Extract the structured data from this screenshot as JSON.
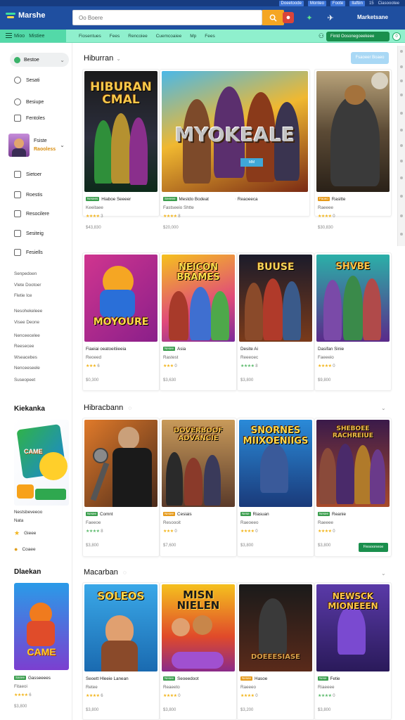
{
  "header": {
    "logo_text": "Marshe",
    "search_placeholder": "Oo Boere",
    "right_text": "Marketsane",
    "top_links": [
      "Doeetoode",
      "Monteo",
      "Foote",
      "Ilaftiin",
      "15",
      "Ciasoootee"
    ]
  },
  "nav": {
    "menu_label": "Mioo",
    "menu_label2": "Mistiee",
    "links": [
      "Fiosentues",
      "Fees",
      "Rencoiee",
      "Cuemcoaiee",
      "Mp",
      "Fees"
    ],
    "cta": "Fintd Oosonegoeekeee"
  },
  "sidebar": {
    "home": "Bestoe",
    "items": [
      "Sesati",
      "Besiupe",
      "Fentoles"
    ],
    "profile": {
      "name": "Fsiste",
      "level": "Raooless"
    },
    "items2": [
      "Sietoer",
      "Roestis",
      "Resocilere",
      "Sesiteig",
      "Fesiells"
    ],
    "links": [
      "Senpedoen",
      "Vlete Dootoer",
      "Fletie Ice",
      "Nesohekeleee",
      "Visee Deone",
      "Nenceecelee",
      "Reesecee",
      "Wseacebes",
      "Nenceeseele",
      "Suseopeet"
    ],
    "section1": {
      "title": "Kiekanka",
      "sub1": "Nestsbeveeoo",
      "sub2": "Nata",
      "item1": "Gieee",
      "item2": "Coaee"
    },
    "section2": {
      "title": "Dlaekan",
      "badge": "Sanee",
      "name": "Gasseeees",
      "meta": "Fitaeoi",
      "stars": "★★★★",
      "rating": "6",
      "price": "$3,800"
    }
  },
  "sections": [
    {
      "title": "Hiburran",
      "button": "Fsaoeer Boaeo",
      "cards": [
        {
          "cover": "HIBURAN CMAL",
          "badge": "Nesees",
          "name": "Hiaboe Seeeer",
          "meta": "Keeitaee",
          "stars": "★★★★",
          "rating": "3",
          "price": "$43,830"
        },
        {
          "cover": "MYOKEALE",
          "badge": "Seeeee",
          "name": "Mestdo Bodeat",
          "meta": "Fastseeio Shtte",
          "stars": "★★★★",
          "rating": "8",
          "price": "$20,000",
          "extra": "Reaoeeca"
        },
        {
          "cover": "",
          "badge": "Faoeo",
          "name": "Rasitte",
          "meta": "Raeeee",
          "stars": "★★★★",
          "rating": "0",
          "price": "$30,830"
        }
      ]
    },
    {
      "title": "",
      "cards": [
        {
          "cover": "MOYOURE",
          "badge": "",
          "name": "Fiaeiai oeatoeitiieeia",
          "meta": "Reoeed",
          "stars": "★★★",
          "rating": "6",
          "price": "$0,300"
        },
        {
          "cover": "NEICON BRAMES",
          "badge": "Nesee",
          "name": "Asia",
          "meta": "Rastest",
          "stars": "★★★",
          "rating": "0",
          "price": "$3,630"
        },
        {
          "cover": "BUUSE",
          "badge": "",
          "name": "Desite Ai",
          "meta": "Reeeoec",
          "stars": "★★★★",
          "rating": "8",
          "price": "$3,800"
        },
        {
          "cover": "SHVBE",
          "badge": "",
          "name": "Dasifan Sinie",
          "meta": "Faeeeio",
          "stars": "★★★★",
          "rating": "0",
          "price": "$9,800"
        }
      ]
    },
    {
      "title": "Hibracbann",
      "cards": [
        {
          "cover": "",
          "badge": "Nesee",
          "name": "Comnt",
          "meta": "Faeeoe",
          "stars": "★★★★",
          "rating": "8",
          "price": "$3,800"
        },
        {
          "cover": "DOVERBOOF ADVANCIE",
          "badge": "Nesee",
          "name": "Cesiais",
          "meta": "Resoooit",
          "stars": "★★★",
          "rating": "0",
          "price": "$7,600"
        },
        {
          "cover": "SNORNES MIIXOENIIGS",
          "badge": "Nese",
          "name": "Riasuan",
          "meta": "Raeoeeo",
          "stars": "★★★★",
          "rating": "0",
          "price": "$3,800"
        },
        {
          "cover": "SHEBOEE RACHREIUE",
          "badge": "Nesee",
          "name": "Reanie",
          "meta": "Raeeee",
          "stars": "★★★★",
          "rating": "0",
          "price": "$3,800",
          "button": "Fiesooneoe"
        }
      ]
    },
    {
      "title": "Macarban",
      "cards": [
        {
          "cover": "SOLEOS",
          "badge": "",
          "name": "Seoett Hleeie Lanean",
          "meta": "Retee",
          "stars": "★★★★",
          "rating": "6",
          "price": "$3,800"
        },
        {
          "cover": "MISN NIELEN",
          "badge": "Nesee",
          "name": "Seoeedoot",
          "meta": "Reaeeto",
          "stars": "★★★★",
          "rating": "0",
          "price": "$3,800"
        },
        {
          "cover": "DOEEESIASE",
          "badge": "Nesee",
          "name": "Hasoe",
          "meta": "Raeeeo",
          "stars": "★★★★",
          "rating": "0",
          "price": "$3,200"
        },
        {
          "cover": "NEWSCK MIONEEEN",
          "badge": "Nese",
          "name": "Fetie",
          "meta": "Riaeeee",
          "stars": "★★★★",
          "rating": "0",
          "price": "$3,800"
        }
      ]
    }
  ],
  "colors": {
    "header": "#1f4fa0",
    "nav": "#8ff0cd",
    "accent": "#f5a623",
    "green": "#1a8f4d"
  }
}
